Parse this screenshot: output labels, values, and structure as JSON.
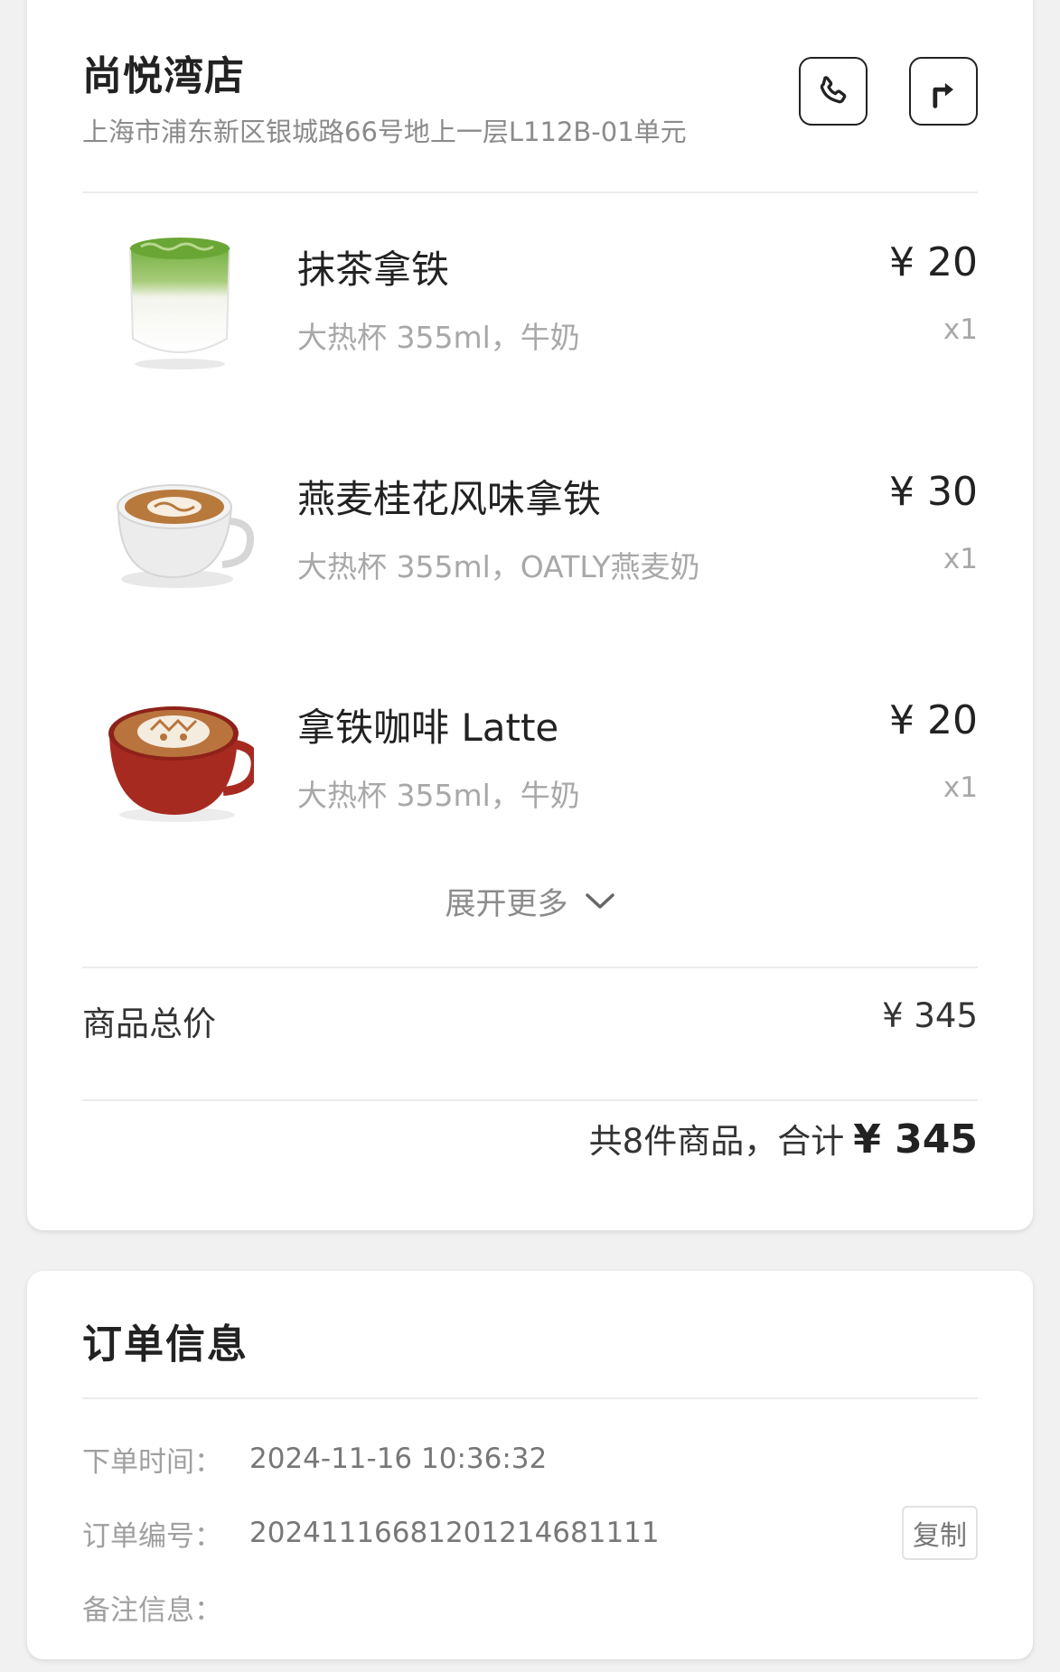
{
  "store": {
    "name": "尚悦湾店",
    "address": "上海市浦东新区银城路66号地上一层L112B-01单元"
  },
  "items": [
    {
      "name": "抹茶拿铁",
      "spec": "大热杯 355ml，牛奶",
      "price": "¥ 20",
      "qty": "x1",
      "image": "matcha-latte"
    },
    {
      "name": "燕麦桂花风味拿铁",
      "spec": "大热杯 355ml，OATLY燕麦奶",
      "price": "¥ 30",
      "qty": "x1",
      "image": "osmanthus-oat-latte"
    },
    {
      "name": "拿铁咖啡 Latte",
      "spec": "大热杯 355ml，牛奶",
      "price": "¥ 20",
      "qty": "x1",
      "image": "latte"
    }
  ],
  "expand_label": "展开更多",
  "totals": {
    "label": "商品总价",
    "value": "¥ 345",
    "summary_text": "共8件商品，合计",
    "summary_amount": "¥ 345"
  },
  "order_info": {
    "title": "订单信息",
    "rows": [
      {
        "label": "下单时间：",
        "value": "2024-11-16 10:36:32"
      },
      {
        "label": "订单编号：",
        "value": "20241116681201214681111",
        "action": "复制"
      },
      {
        "label": "备注信息：",
        "value": ""
      }
    ]
  },
  "icons": {
    "phone": "phone-icon",
    "navigate": "turn-right-arrow-icon",
    "expand": "chevron-down-icon"
  }
}
